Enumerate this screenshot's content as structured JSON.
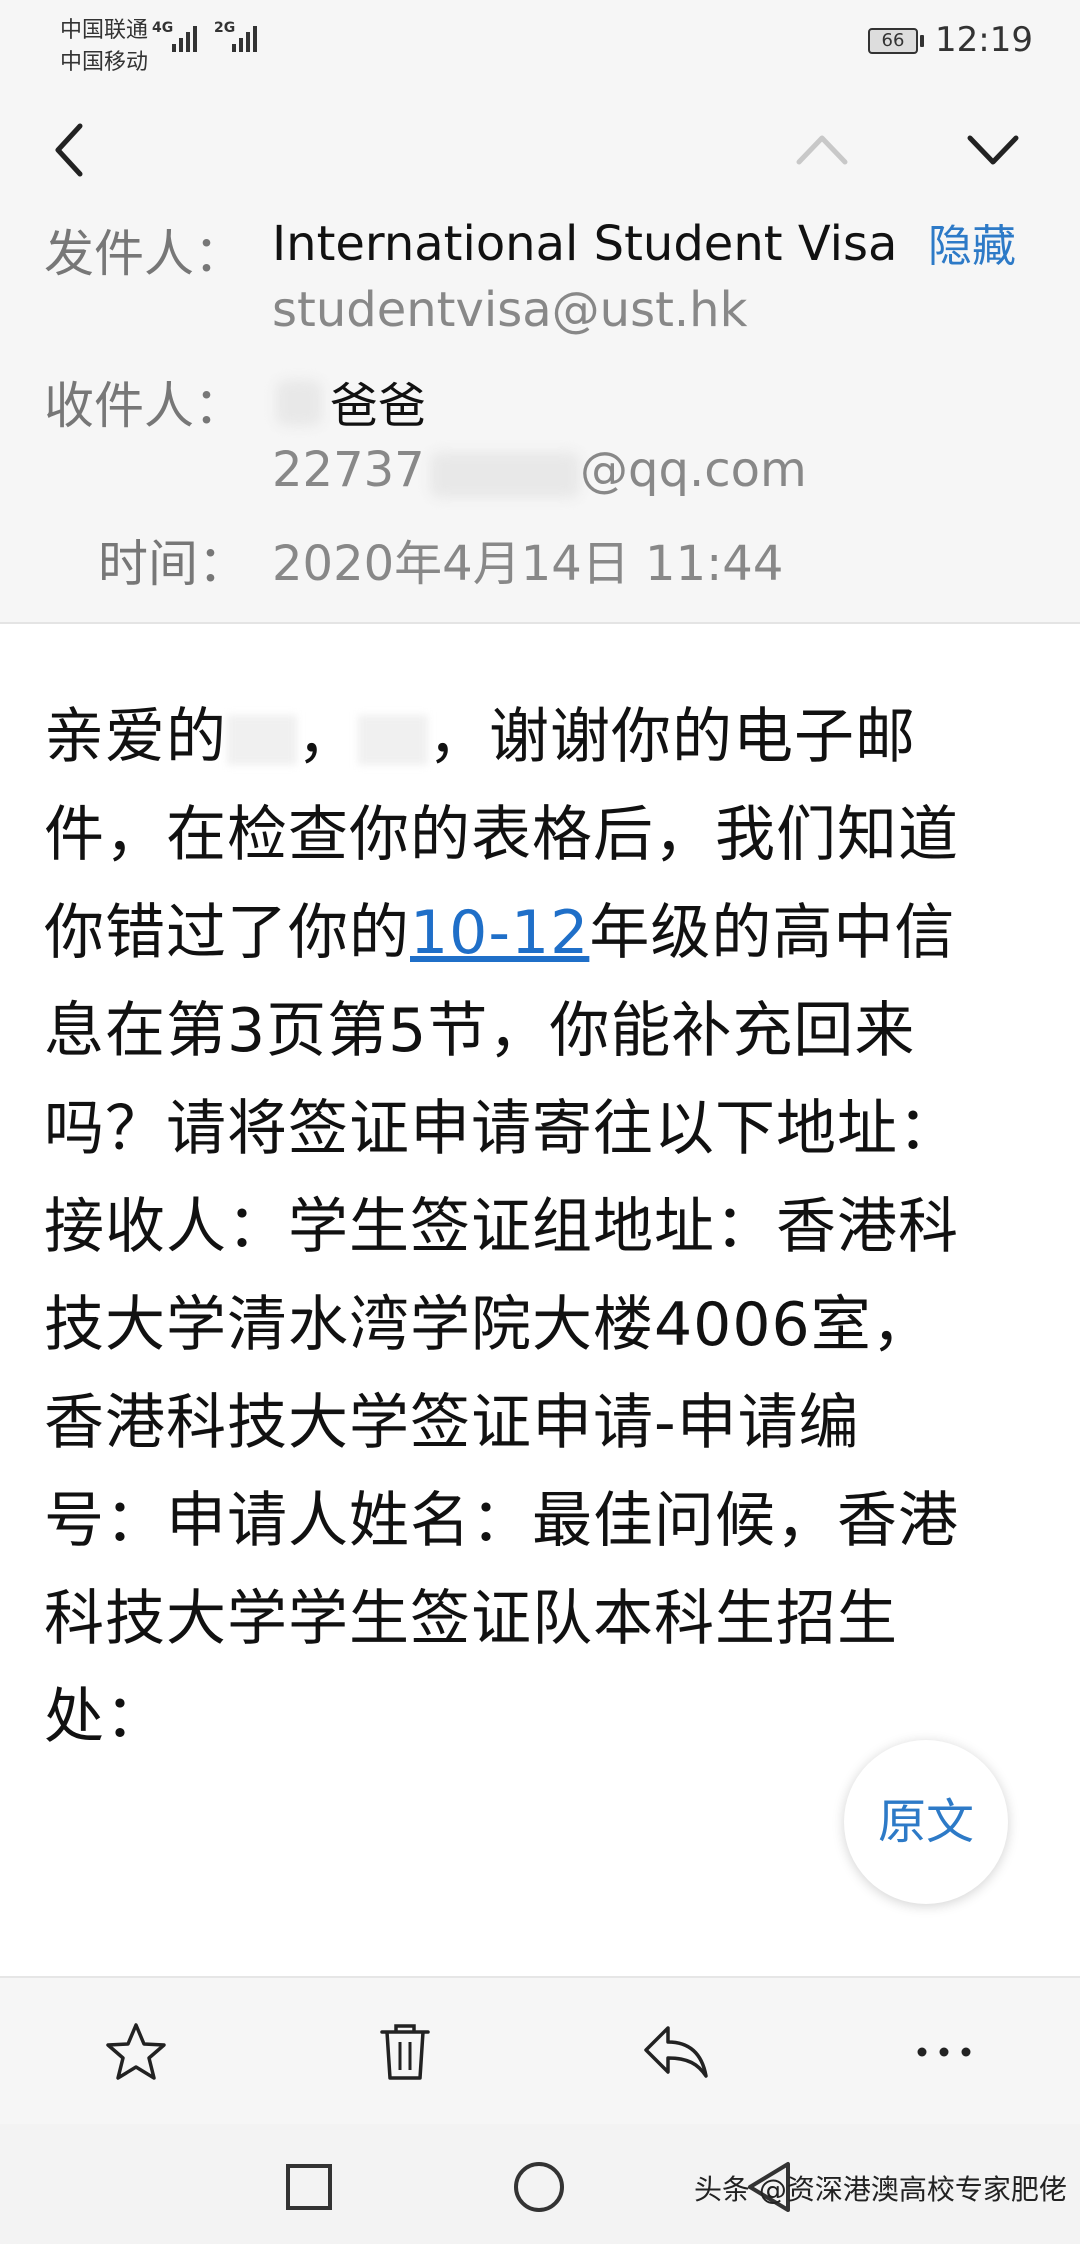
{
  "status_bar": {
    "carrier_1": "中国联通",
    "carrier_2": "中国移动",
    "net_1": "4G",
    "net_2": "2G",
    "battery": "66",
    "time": "12:19"
  },
  "nav": {
    "back_icon": "chevron-left-icon",
    "prev_icon": "chevron-up-icon",
    "next_icon": "chevron-down-icon"
  },
  "header": {
    "from_label": "发件人：",
    "from_name": "International Student Visa",
    "from_email": "studentvisa@ust.hk",
    "hide_label": "隐藏",
    "to_label": "收件人：",
    "to_name": "爸爸",
    "to_email_prefix": "22737",
    "to_email_suffix": "@qq.com",
    "time_label": "时间：",
    "time_value": "2020年4月14日 11:44"
  },
  "body": {
    "line1_a": "亲爱的",
    "line1_b": "，",
    "line1_c": "，谢谢你的电子邮",
    "line2": "件，在检查你的表格后，我们知道",
    "line3_a": "你错过了你的",
    "line3_link": "10-12",
    "line3_b": "年级的高中信",
    "line4": "息在第3页第5节，你能补充回来",
    "line5": "吗？请将签证申请寄往以下地址：",
    "line6": "接收人：学生签证组地址：香港科",
    "line7": "技大学清水湾学院大楼4006室，",
    "line8": "香港科技大学签证申请-申请编",
    "line9": "号：申请人姓名：最佳问候，香港",
    "line10": "科技大学学生签证队本科生招生",
    "line11": "处："
  },
  "original_button": "原文",
  "actions": {
    "star_icon": "star-icon",
    "delete_icon": "trash-icon",
    "reply_icon": "reply-icon",
    "more_icon": "more-icon"
  },
  "system_nav": {
    "recents_icon": "square-icon",
    "home_icon": "circle-icon",
    "back_icon": "triangle-back-icon"
  },
  "watermark": "头条 @资深港澳高校专家肥佬"
}
